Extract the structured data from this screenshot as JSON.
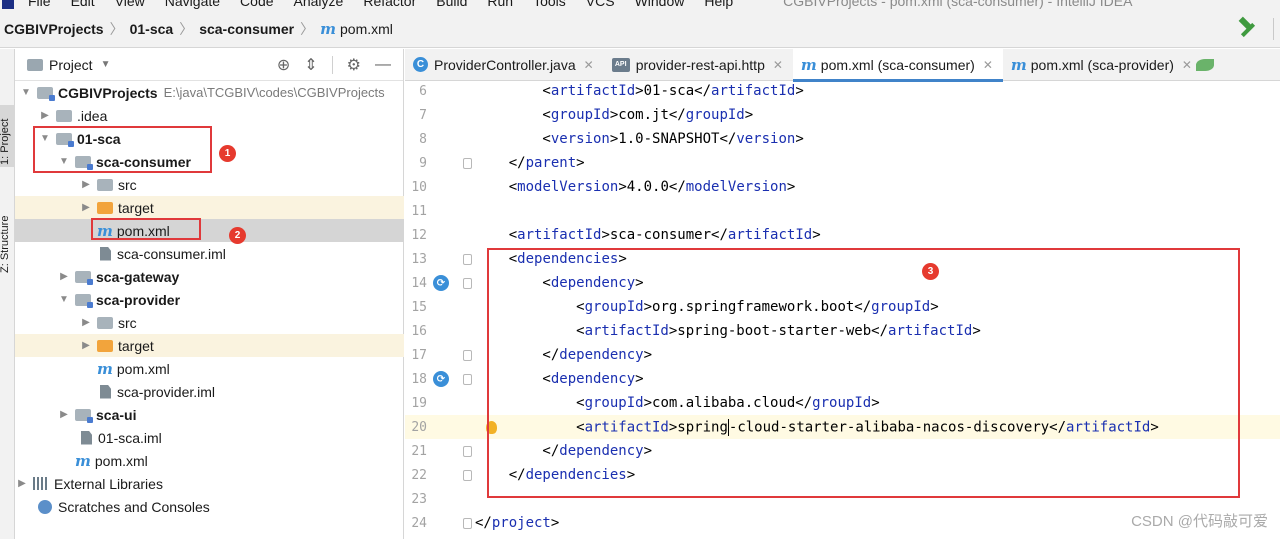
{
  "menubar": {
    "items": [
      "File",
      "Edit",
      "View",
      "Navigate",
      "Code",
      "Analyze",
      "Refactor",
      "Build",
      "Run",
      "Tools",
      "VCS",
      "Window",
      "Help"
    ],
    "window_title": "CGBIVProjects - pom.xml (sca-consumer) - IntelliJ IDEA"
  },
  "breadcrumb": {
    "project": "CGBIVProjects",
    "module": "01-sca",
    "submodule": "sca-consumer",
    "file": "pom.xml"
  },
  "toolstrip": {
    "project_tab": "1: Project",
    "structure_tab": "Z: Structure"
  },
  "project_panel": {
    "title": "Project",
    "root_label": "CGBIVProjects",
    "root_path": "E:\\java\\TCGBIV\\codes\\CGBIVProjects",
    "tree": [
      {
        "label": "CGBIVProjects",
        "bold": true
      },
      {
        "label": ".idea"
      },
      {
        "label": "01-sca",
        "bold": true
      },
      {
        "label": "sca-consumer",
        "bold": true
      },
      {
        "label": "src"
      },
      {
        "label": "target"
      },
      {
        "label": "pom.xml"
      },
      {
        "label": "sca-consumer.iml"
      },
      {
        "label": "sca-gateway",
        "bold": true
      },
      {
        "label": "sca-provider",
        "bold": true
      },
      {
        "label": "src"
      },
      {
        "label": "target"
      },
      {
        "label": "pom.xml"
      },
      {
        "label": "sca-provider.iml"
      },
      {
        "label": "sca-ui",
        "bold": true
      },
      {
        "label": "01-sca.iml"
      },
      {
        "label": "pom.xml"
      },
      {
        "label": "External Libraries"
      },
      {
        "label": "Scratches and Consoles"
      }
    ]
  },
  "annotations": {
    "badge1": "1",
    "badge2": "2",
    "badge3": "3"
  },
  "tabs": [
    {
      "label": "ProviderController.java",
      "icon": "class-icon"
    },
    {
      "label": "provider-rest-api.http",
      "icon": "api-icon"
    },
    {
      "label": "pom.xml (sca-consumer)",
      "icon": "maven-icon",
      "active": true
    },
    {
      "label": "pom.xml (sca-provider)",
      "icon": "maven-icon"
    }
  ],
  "editor": {
    "lines": [
      {
        "num": "6",
        "code": "        <artifactId>01-sca</artifactId>"
      },
      {
        "num": "7",
        "code": "        <groupId>com.jt</groupId>"
      },
      {
        "num": "8",
        "code": "        <version>1.0-SNAPSHOT</version>"
      },
      {
        "num": "9",
        "code": "    </parent>"
      },
      {
        "num": "10",
        "code": "    <modelVersion>4.0.0</modelVersion>"
      },
      {
        "num": "11",
        "code": ""
      },
      {
        "num": "12",
        "code": "    <artifactId>sca-consumer</artifactId>"
      },
      {
        "num": "13",
        "code": "    <dependencies>"
      },
      {
        "num": "14",
        "code": "        <dependency>"
      },
      {
        "num": "15",
        "code": "            <groupId>org.springframework.boot</groupId>"
      },
      {
        "num": "16",
        "code": "            <artifactId>spring-boot-starter-web</artifactId>"
      },
      {
        "num": "17",
        "code": "        </dependency>"
      },
      {
        "num": "18",
        "code": "        <dependency>"
      },
      {
        "num": "19",
        "code": "            <groupId>com.alibaba.cloud</groupId>"
      },
      {
        "num": "20",
        "code": "            <artifactId>spring-cloud-starter-alibaba-nacos-discovery</artifactId>"
      },
      {
        "num": "21",
        "code": "        </dependency>"
      },
      {
        "num": "22",
        "code": "    </dependencies>"
      },
      {
        "num": "23",
        "code": ""
      },
      {
        "num": "24",
        "code": "</project>"
      }
    ]
  },
  "watermark": "CSDN @代码敲可爱",
  "colors": {
    "tag": "#1a2fb0",
    "annotation_red": "#e0393b",
    "active_tab_underline": "#4083c9"
  }
}
